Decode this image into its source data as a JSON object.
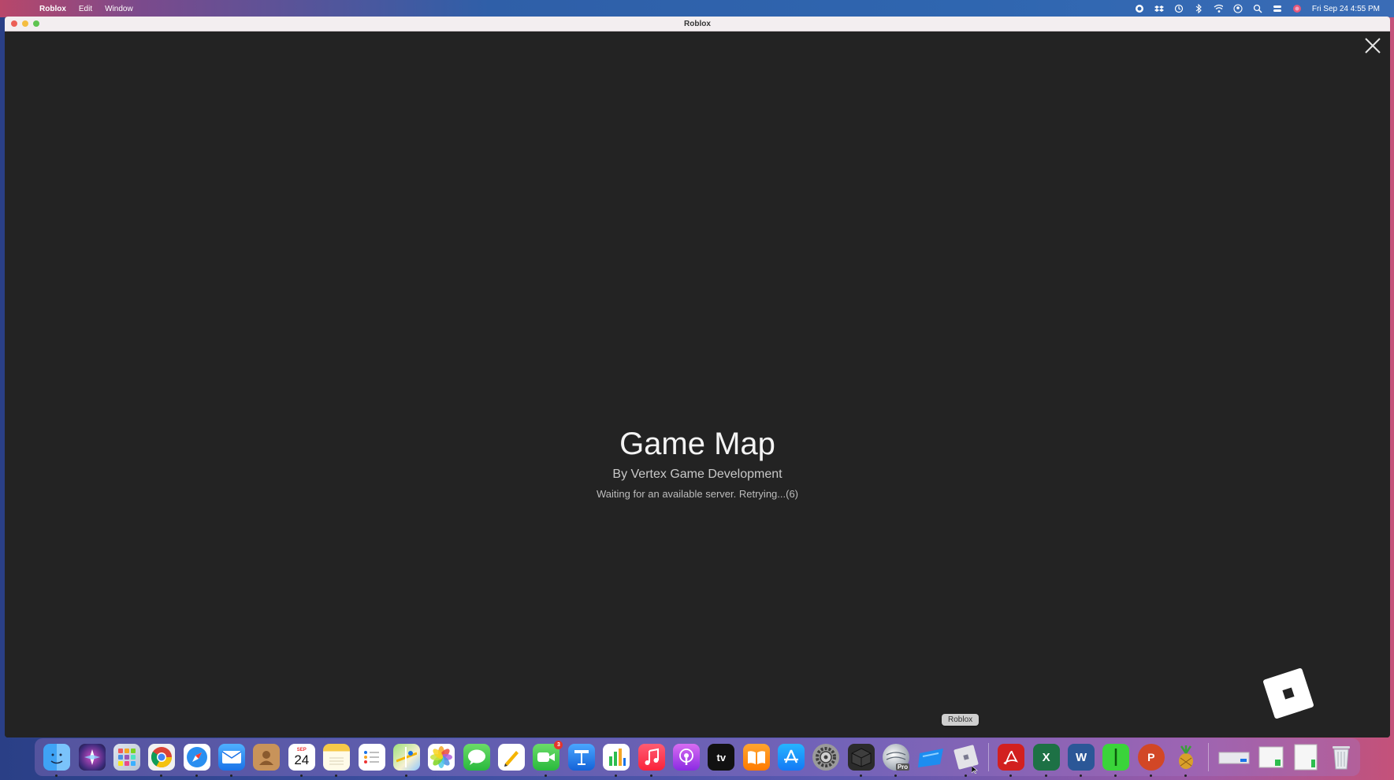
{
  "menubar": {
    "app_name": "Roblox",
    "menus": [
      "Edit",
      "Window"
    ],
    "clock": "Fri Sep 24  4:55 PM"
  },
  "window": {
    "title": "Roblox"
  },
  "loading": {
    "game_title": "Game Map",
    "author": "By Vertex Game Development",
    "status": "Waiting for an available server. Retrying...(6)"
  },
  "dock": {
    "tooltip": "Roblox",
    "calendar_month": "SEP",
    "calendar_day": "24",
    "facetime_badge": "3",
    "appletv_label": "tv",
    "pro_label": "Pro",
    "excel_label": "X",
    "word_label": "W",
    "ppt_label": "P"
  },
  "colors": {
    "window_bg": "#232323",
    "accent_red": "#ec5f57",
    "accent_yellow": "#f4bd41",
    "accent_green": "#5fc451"
  }
}
